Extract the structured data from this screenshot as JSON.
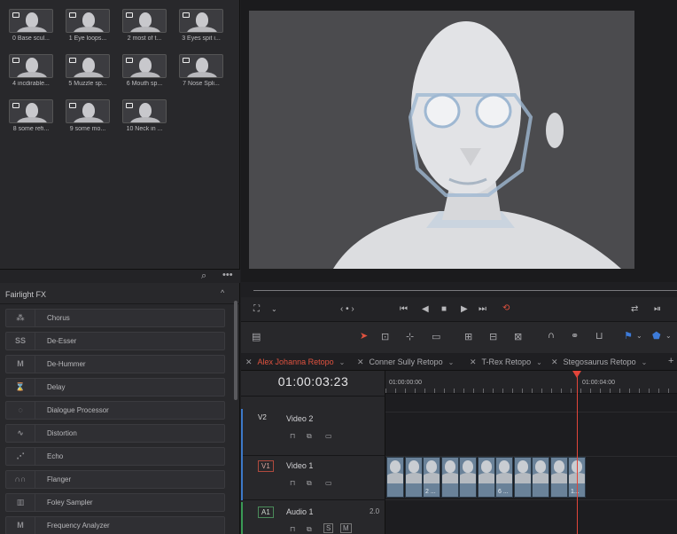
{
  "media_pool": {
    "clips": [
      {
        "label": "0 Base scul..."
      },
      {
        "label": "1 Eye loops..."
      },
      {
        "label": "2 most of t..."
      },
      {
        "label": "3 Eyes spit i..."
      },
      {
        "label": "4 incdirable..."
      },
      {
        "label": "5 Muzzle sp..."
      },
      {
        "label": "6 Mouth sp..."
      },
      {
        "label": "7 Nose Spli..."
      },
      {
        "label": "8 some refi..."
      },
      {
        "label": "9 some mo..."
      },
      {
        "label": "10 Neck in ..."
      }
    ]
  },
  "fx": {
    "title": "Fairlight FX",
    "items": [
      {
        "icon": "chorus-icon",
        "glyph": "⁂",
        "name": "Chorus"
      },
      {
        "icon": "de-esser-icon",
        "glyph": "SS",
        "name": "De-Esser"
      },
      {
        "icon": "de-hummer-icon",
        "glyph": "M",
        "name": "De-Hummer"
      },
      {
        "icon": "delay-icon",
        "glyph": "⌛",
        "name": "Delay"
      },
      {
        "icon": "dialogue-processor-icon",
        "glyph": "◌",
        "name": "Dialogue Processor"
      },
      {
        "icon": "distortion-icon",
        "glyph": "∿",
        "name": "Distortion"
      },
      {
        "icon": "echo-icon",
        "glyph": "⋰",
        "name": "Echo"
      },
      {
        "icon": "flanger-icon",
        "glyph": "∩∩",
        "name": "Flanger"
      },
      {
        "icon": "foley-sampler-icon",
        "glyph": "▥",
        "name": "Foley Sampler"
      },
      {
        "icon": "frequency-analyzer-icon",
        "glyph": "M",
        "name": "Frequency Analyzer"
      }
    ]
  },
  "tabs": [
    {
      "label": "Alex Johanna Retopo",
      "active": true
    },
    {
      "label": "Conner Sully Retopo",
      "active": false
    },
    {
      "label": "T-Rex Retopo",
      "active": false
    },
    {
      "label": "Stegosaurus Retopo",
      "active": false
    }
  ],
  "timeline": {
    "timecode": "01:00:03:23",
    "ruler": [
      "01:00:00:00",
      "01:00:04:00"
    ],
    "tracks": [
      {
        "id": "V2",
        "name": "Video 2"
      },
      {
        "id": "V1",
        "name": "Video 1"
      },
      {
        "id": "A1",
        "name": "Audio 1",
        "channels": "2.0"
      }
    ],
    "clip_labels": [
      "2 ...",
      "6 ...",
      "1..."
    ]
  },
  "colors": {
    "accent": "#e0523f",
    "playhead": "#e2453a",
    "clip": "#6a8299"
  }
}
